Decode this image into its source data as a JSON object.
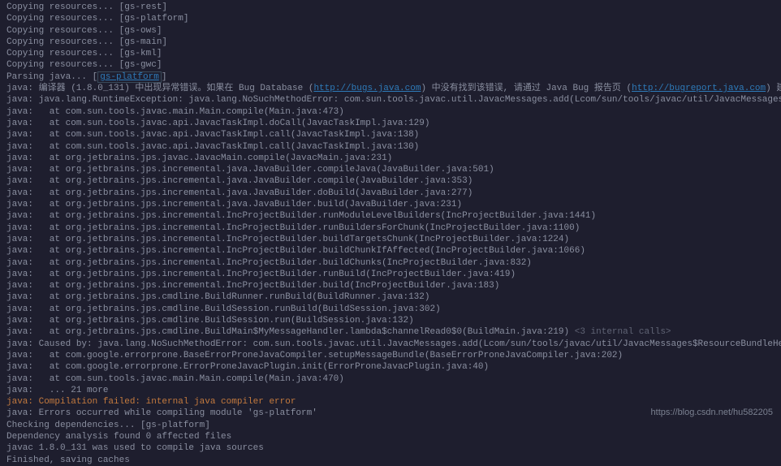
{
  "lines": [
    {
      "type": "plain",
      "text": "Copying resources... [gs-rest]"
    },
    {
      "type": "plain",
      "text": "Copying resources... [gs-platform]"
    },
    {
      "type": "plain",
      "text": "Copying resources... [gs-ows]"
    },
    {
      "type": "plain",
      "text": "Copying resources... [gs-main]"
    },
    {
      "type": "plain",
      "text": "Copying resources... [gs-kml]"
    },
    {
      "type": "plain",
      "text": "Copying resources... [gs-gwc]"
    },
    {
      "type": "parsing",
      "prefix": "Parsing java... [",
      "link": "gs-platform",
      "suffix": "]"
    },
    {
      "type": "error-head",
      "prefix": "java: 编译器 (1.8.0_131) 中出现异常错误。如果在 Bug Database (",
      "link1": "http://bugs.java.com",
      "mid": ") 中没有找到该错误, 请通过 Java Bug 报告页 (",
      "link2": "http://bugreport.java.com",
      "suffix": ") 建立该 Java 编译器 Bug。请在报告中附上您的程序和以"
    },
    {
      "type": "plain",
      "text": "java: java.lang.RuntimeException: java.lang.NoSuchMethodError: com.sun.tools.javac.util.JavacMessages.add(Lcom/sun/tools/javac/util/JavacMessages$ResourceBundleHelper;)V"
    },
    {
      "type": "plain",
      "text": "java:   at com.sun.tools.javac.main.Main.compile(Main.java:473)"
    },
    {
      "type": "plain",
      "text": "java:   at com.sun.tools.javac.api.JavacTaskImpl.doCall(JavacTaskImpl.java:129)"
    },
    {
      "type": "plain",
      "text": "java:   at com.sun.tools.javac.api.JavacTaskImpl.call(JavacTaskImpl.java:138)"
    },
    {
      "type": "plain",
      "text": "java:   at com.sun.tools.javac.api.JavacTaskImpl.call(JavacTaskImpl.java:130)"
    },
    {
      "type": "plain",
      "text": "java:   at org.jetbrains.jps.javac.JavacMain.compile(JavacMain.java:231)"
    },
    {
      "type": "plain",
      "text": "java:   at org.jetbrains.jps.incremental.java.JavaBuilder.compileJava(JavaBuilder.java:501)"
    },
    {
      "type": "plain",
      "text": "java:   at org.jetbrains.jps.incremental.java.JavaBuilder.compile(JavaBuilder.java:353)"
    },
    {
      "type": "plain",
      "text": "java:   at org.jetbrains.jps.incremental.java.JavaBuilder.doBuild(JavaBuilder.java:277)"
    },
    {
      "type": "plain",
      "text": "java:   at org.jetbrains.jps.incremental.java.JavaBuilder.build(JavaBuilder.java:231)"
    },
    {
      "type": "plain",
      "text": "java:   at org.jetbrains.jps.incremental.IncProjectBuilder.runModuleLevelBuilders(IncProjectBuilder.java:1441)"
    },
    {
      "type": "plain",
      "text": "java:   at org.jetbrains.jps.incremental.IncProjectBuilder.runBuildersForChunk(IncProjectBuilder.java:1100)"
    },
    {
      "type": "plain",
      "text": "java:   at org.jetbrains.jps.incremental.IncProjectBuilder.buildTargetsChunk(IncProjectBuilder.java:1224)"
    },
    {
      "type": "plain",
      "text": "java:   at org.jetbrains.jps.incremental.IncProjectBuilder.buildChunkIfAffected(IncProjectBuilder.java:1066)"
    },
    {
      "type": "plain",
      "text": "java:   at org.jetbrains.jps.incremental.IncProjectBuilder.buildChunks(IncProjectBuilder.java:832)"
    },
    {
      "type": "plain",
      "text": "java:   at org.jetbrains.jps.incremental.IncProjectBuilder.runBuild(IncProjectBuilder.java:419)"
    },
    {
      "type": "plain",
      "text": "java:   at org.jetbrains.jps.incremental.IncProjectBuilder.build(IncProjectBuilder.java:183)"
    },
    {
      "type": "plain",
      "text": "java:   at org.jetbrains.jps.cmdline.BuildRunner.runBuild(BuildRunner.java:132)"
    },
    {
      "type": "plain",
      "text": "java:   at org.jetbrains.jps.cmdline.BuildSession.runBuild(BuildSession.java:302)"
    },
    {
      "type": "plain",
      "text": "java:   at org.jetbrains.jps.cmdline.BuildSession.run(BuildSession.java:132)"
    },
    {
      "type": "internal",
      "text": "java:   at org.jetbrains.jps.cmdline.BuildMain$MyMessageHandler.lambda$channelRead0$0(BuildMain.java:219) ",
      "hint": "<3 internal calls>"
    },
    {
      "type": "plain",
      "text": "java: Caused by: java.lang.NoSuchMethodError: com.sun.tools.javac.util.JavacMessages.add(Lcom/sun/tools/javac/util/JavacMessages$ResourceBundleHelper;)V"
    },
    {
      "type": "plain",
      "text": "java:   at com.google.errorprone.BaseErrorProneJavaCompiler.setupMessageBundle(BaseErrorProneJavaCompiler.java:202)"
    },
    {
      "type": "plain",
      "text": "java:   at com.google.errorprone.ErrorProneJavacPlugin.init(ErrorProneJavacPlugin.java:40)"
    },
    {
      "type": "plain",
      "text": "java:   at com.sun.tools.javac.main.Main.compile(Main.java:470)"
    },
    {
      "type": "plain",
      "text": "java:   ... 21 more"
    },
    {
      "type": "orange",
      "text": "java: Compilation failed: internal java compiler error"
    },
    {
      "type": "plain",
      "text": "java: Errors occurred while compiling module 'gs-platform'"
    },
    {
      "type": "plain",
      "text": "Checking dependencies... [gs-platform]"
    },
    {
      "type": "plain",
      "text": "Dependency analysis found 0 affected files"
    },
    {
      "type": "plain",
      "text": "javac 1.8.0_131 was used to compile java sources"
    },
    {
      "type": "plain",
      "text": "Finished, saving caches       "
    }
  ],
  "watermark": "https://blog.csdn.net/hu582205"
}
